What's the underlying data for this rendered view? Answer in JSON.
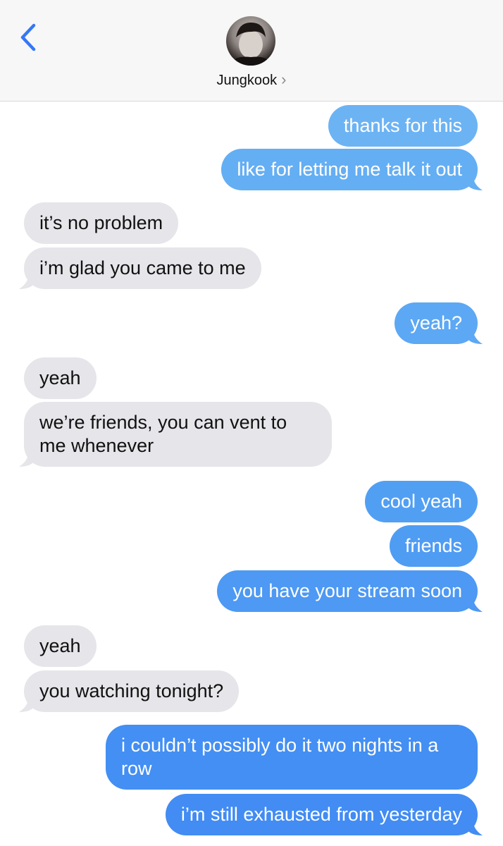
{
  "header": {
    "contact_name": "Jungkook",
    "chevron": "›",
    "back_icon": "chevron-left-icon",
    "accent": "#3478f6"
  },
  "messages": [
    {
      "dir": "out",
      "text": "thanks for this",
      "color": "#6cb3f4"
    },
    {
      "dir": "out",
      "text": "like for letting me talk it out",
      "color": "#64aef4"
    },
    {
      "dir": "in",
      "text": "it’s no problem"
    },
    {
      "dir": "in",
      "text": "i’m glad you came to me"
    },
    {
      "dir": "out",
      "text": "yeah?",
      "color": "#5ca8f4"
    },
    {
      "dir": "in",
      "text": "yeah"
    },
    {
      "dir": "in",
      "text": "we’re friends, you can vent to me whenever"
    },
    {
      "dir": "out",
      "text": "cool yeah",
      "color": "#519ff3"
    },
    {
      "dir": "out",
      "text": "friends",
      "color": "#4f9cf3"
    },
    {
      "dir": "out",
      "text": "you have your stream soon",
      "color": "#4d99f3"
    },
    {
      "dir": "in",
      "text": "yeah"
    },
    {
      "dir": "in",
      "text": "you watching tonight?"
    },
    {
      "dir": "out",
      "text": "i couldn’t possibly do it two nights in a row",
      "color": "#438ff3"
    },
    {
      "dir": "out",
      "text": "i’m still exhausted from yesterday",
      "color": "#428cf3"
    }
  ]
}
